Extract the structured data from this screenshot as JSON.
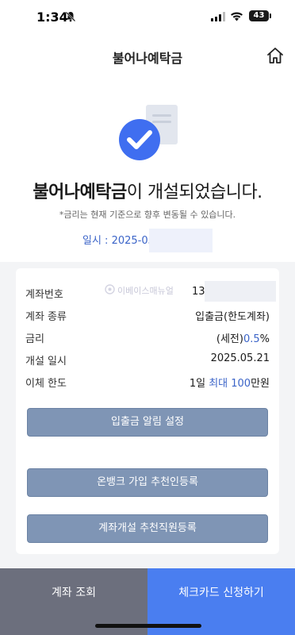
{
  "status_bar": {
    "time": "1:34",
    "battery": "43"
  },
  "header": {
    "title": "불어나예탁금"
  },
  "success": {
    "title_bold": "불어나예탁금",
    "title_rest": "이 개설되었습니다.",
    "notice": "*금리는 현재 기준으로 향후 변동될 수 있습니다.",
    "open_datetime": "일시 : 2025-05"
  },
  "details": {
    "watermark": "이베이스매뉴얼",
    "rows": [
      {
        "label": "계좌번호",
        "value": "13"
      },
      {
        "label": "계좌 종류",
        "value": "입출금(한도계좌)"
      },
      {
        "label": "금리",
        "value_prefix": "(세전)",
        "value_accent": "0.5",
        "value_suffix": "%"
      },
      {
        "label": "개설 일시",
        "value": "2025.05.21"
      },
      {
        "label": "이체 한도",
        "value_prefix": "1일 ",
        "value_accent": "최대 100",
        "value_suffix": "만원"
      }
    ]
  },
  "buttons": {
    "alert_setting": "입출금 알림 설정",
    "onbank_referral": "온뱅크 가입 추천인등록",
    "account_referral": "계좌개설 추천직원등록"
  },
  "bottom": {
    "account_inquiry": "계좌 조회",
    "check_card_apply": "체크카드 신청하기"
  },
  "colors": {
    "accent": "#3b64c8",
    "button": "#7f95b5",
    "cta": "#4a7ef0",
    "secondary": "#6c6f7d"
  }
}
